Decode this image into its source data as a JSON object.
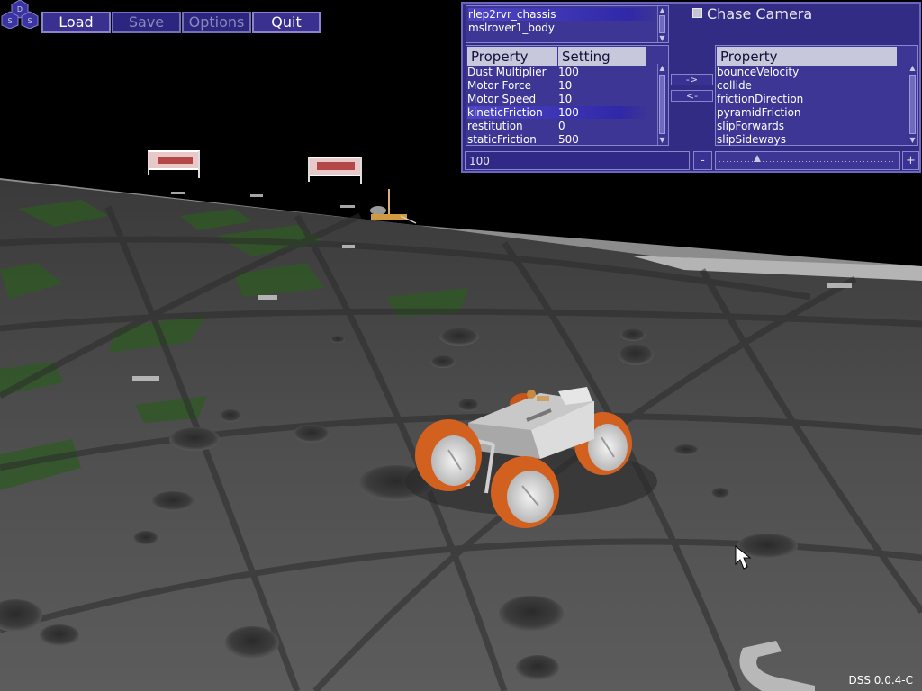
{
  "menu": {
    "logo_letters": [
      "D",
      "S",
      "S"
    ],
    "buttons": [
      {
        "label": "Load",
        "enabled": true
      },
      {
        "label": "Save",
        "enabled": false
      },
      {
        "label": "Options",
        "enabled": false
      },
      {
        "label": "Quit",
        "enabled": true
      }
    ]
  },
  "panel": {
    "bodies": [
      {
        "name": "rlep2rvr_chassis",
        "selected": true
      },
      {
        "name": "mslrover1_body",
        "selected": false
      }
    ],
    "chase_camera": {
      "label": "Chase Camera",
      "checked": false
    },
    "left_table": {
      "headers": [
        "Property",
        "Setting"
      ],
      "rows": [
        {
          "property": "Dust Multiplier",
          "setting": "100",
          "selected": false
        },
        {
          "property": "Motor Force",
          "setting": "10",
          "selected": false
        },
        {
          "property": "Motor Speed",
          "setting": "10",
          "selected": false
        },
        {
          "property": "kineticFriction",
          "setting": "100",
          "selected": true
        },
        {
          "property": "restitution",
          "setting": "0",
          "selected": false
        },
        {
          "property": "staticFriction",
          "setting": "500",
          "selected": false
        }
      ]
    },
    "move_right_label": "->",
    "move_left_label": "<-",
    "right_table": {
      "header": "Property",
      "rows": [
        "bounceVelocity",
        "collide",
        "frictionDirection",
        "pyramidFriction",
        "slipForwards",
        "slipSideways"
      ]
    },
    "value_field": "100",
    "decrement_label": "-",
    "increment_label": "+",
    "slider_fraction": 0.2
  },
  "version": "DSS 0.0.4-C",
  "colors": {
    "panel_bg": "#332c84",
    "panel_border": "#6c66c0",
    "button_bg": "#3a3090",
    "selection": "#2f28a8",
    "ground": "#4a4a4a",
    "sky": "#000000",
    "wheel": "#d2601e"
  }
}
